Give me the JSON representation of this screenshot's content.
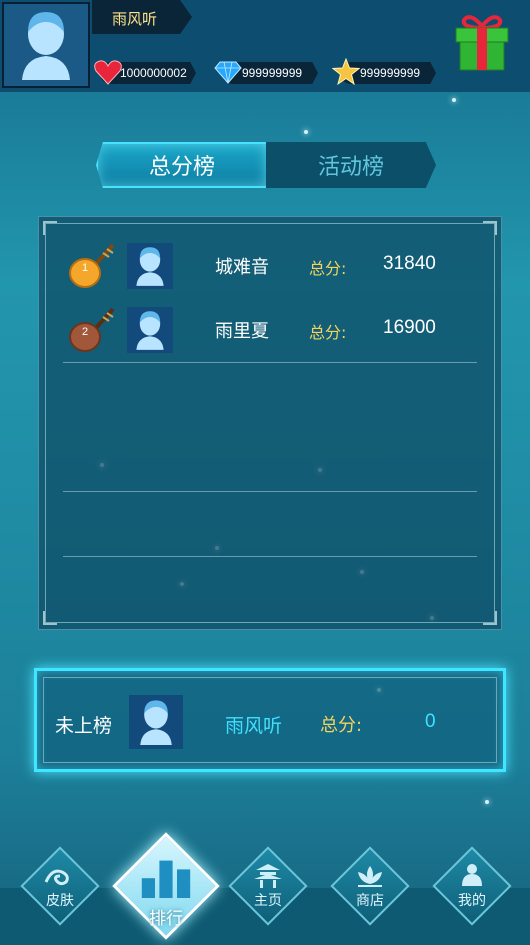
{
  "header": {
    "username": "雨风听",
    "resources": [
      {
        "icon": "heart-icon",
        "value": "1000000002"
      },
      {
        "icon": "diamond-icon",
        "value": "999999999"
      },
      {
        "icon": "star-icon",
        "value": "999999999"
      }
    ],
    "gift_icon": "gift-icon"
  },
  "tabs": [
    {
      "label": "总分榜",
      "active": true
    },
    {
      "label": "活动榜",
      "active": false
    }
  ],
  "leaderboard": {
    "rows": [
      {
        "rank": "1",
        "name": "城难音",
        "score_label": "总分:",
        "score": "31840"
      },
      {
        "rank": "2",
        "name": "雨里夏",
        "score_label": "总分:",
        "score": "16900"
      }
    ]
  },
  "my_rank": {
    "status": "未上榜",
    "name": "雨风听",
    "score_label": "总分:",
    "score": "0"
  },
  "nav": [
    {
      "label": "皮肤",
      "icon": "wave-icon",
      "active": false
    },
    {
      "label": "排行",
      "icon": "bar-chart-icon",
      "active": true
    },
    {
      "label": "主页",
      "icon": "pavilion-icon",
      "active": false
    },
    {
      "label": "商店",
      "icon": "lotus-icon",
      "active": false
    },
    {
      "label": "我的",
      "icon": "person-icon",
      "active": false
    }
  ],
  "colors": {
    "accent": "#3fe0ff",
    "score_label": "#f4d35e",
    "header_bg": "#0d4e70"
  }
}
